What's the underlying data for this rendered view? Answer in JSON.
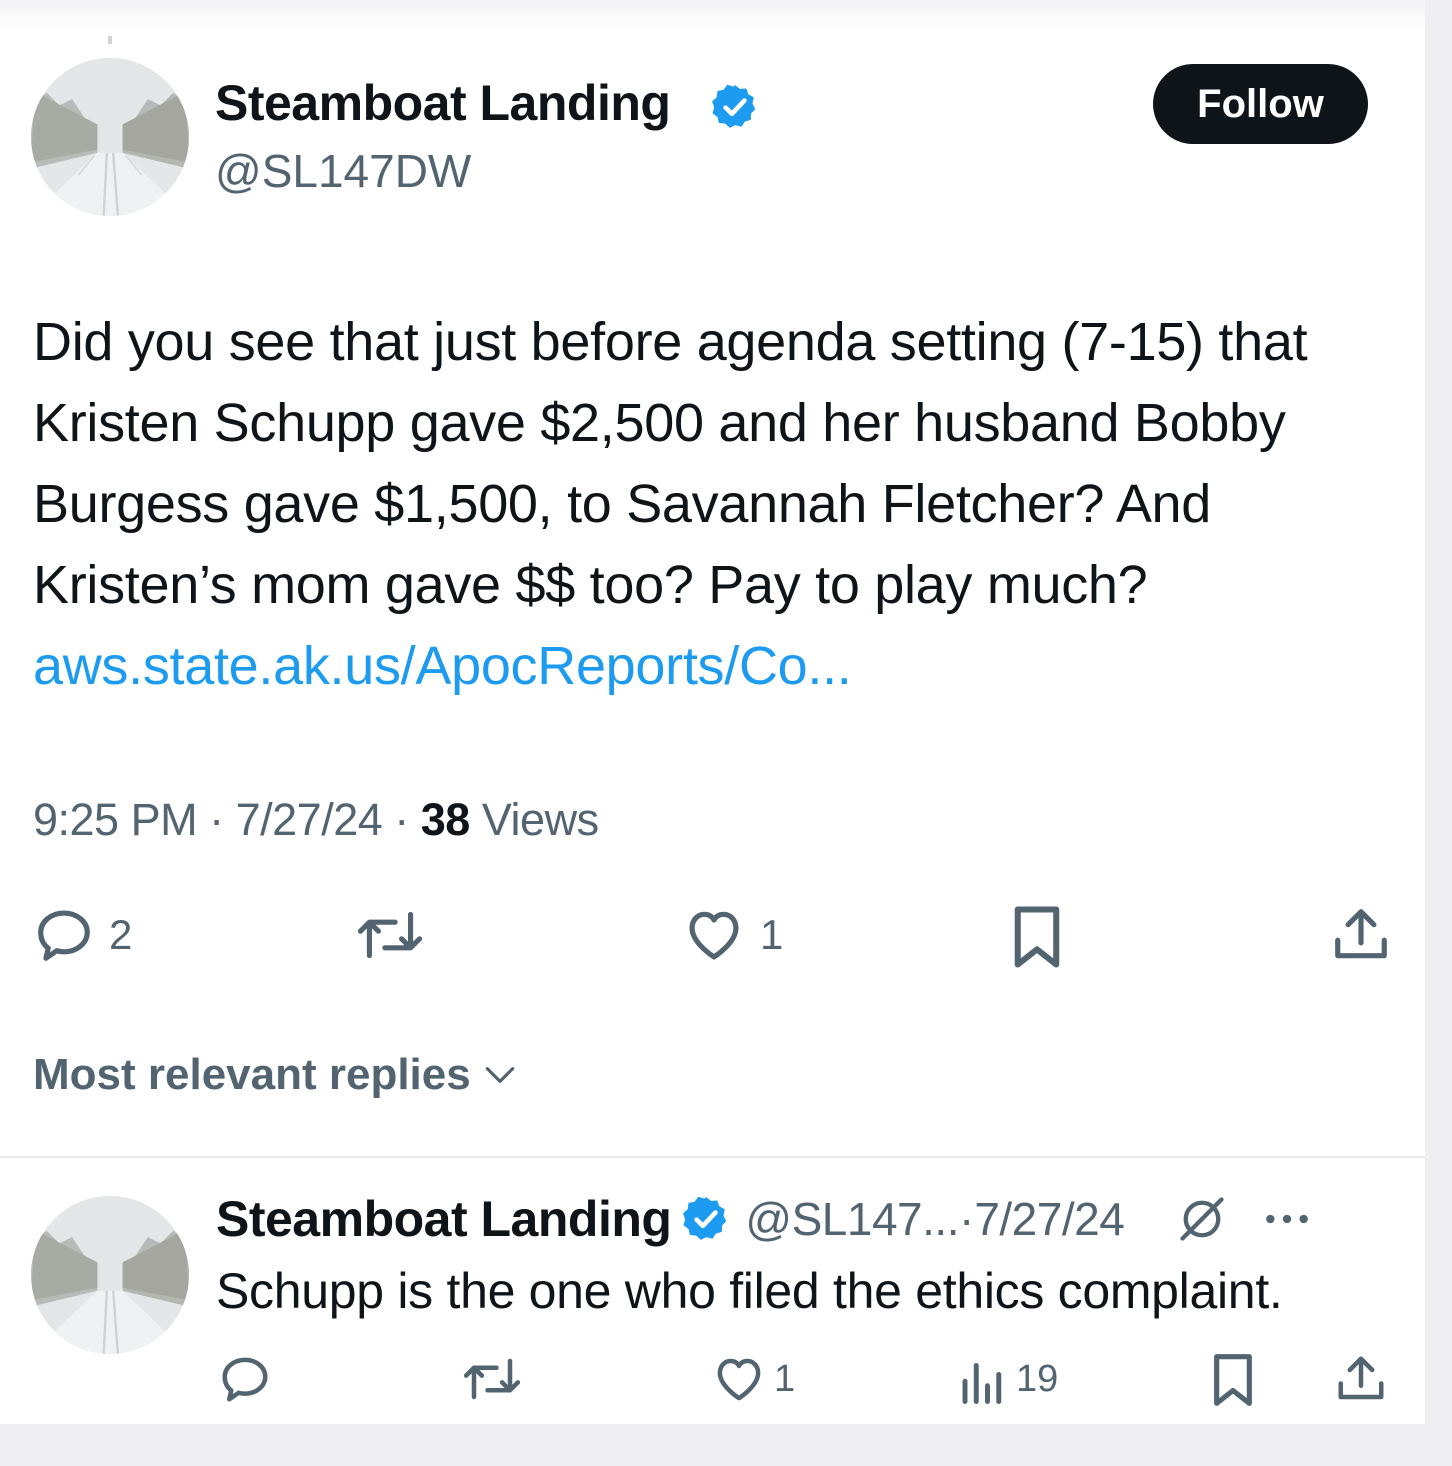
{
  "tweet": {
    "author_name": "Steamboat Landing",
    "author_handle": "@SL147DW",
    "follow_label": "Follow",
    "text_main": "Did you see that just before agenda setting (7-15) that Kristen Schupp gave $2,500 and her husband Bobby Burgess gave $1,500, to Savannah Fletcher? And Kristen’s mom gave $$ too? Pay to play much? ",
    "link_text": "aws.state.ak.us/ApocReports/Co...",
    "time": "9:25 PM",
    "date": "7/27/24",
    "views_count": "38",
    "views_label": "Views",
    "reply_count": "2",
    "like_count": "1"
  },
  "replies_header": {
    "label": "Most relevant replies"
  },
  "reply": {
    "author_name": "Steamboat Landing",
    "author_handle": "@SL147...",
    "date": "7/27/24",
    "text": "Schupp is the one who filed the ethics complaint.",
    "like_count": "1",
    "views_count": "19"
  },
  "colors": {
    "text": "#0f1419",
    "secondary": "#536471",
    "link": "#1d9bf0",
    "verified": "#1d9bf0",
    "button": "#0f1419"
  },
  "icons": [
    "verified-badge-icon",
    "reply-icon",
    "repost-icon",
    "like-icon",
    "bookmark-icon",
    "share-icon",
    "chevron-down-icon",
    "grok-icon",
    "more-icon",
    "views-icon"
  ]
}
